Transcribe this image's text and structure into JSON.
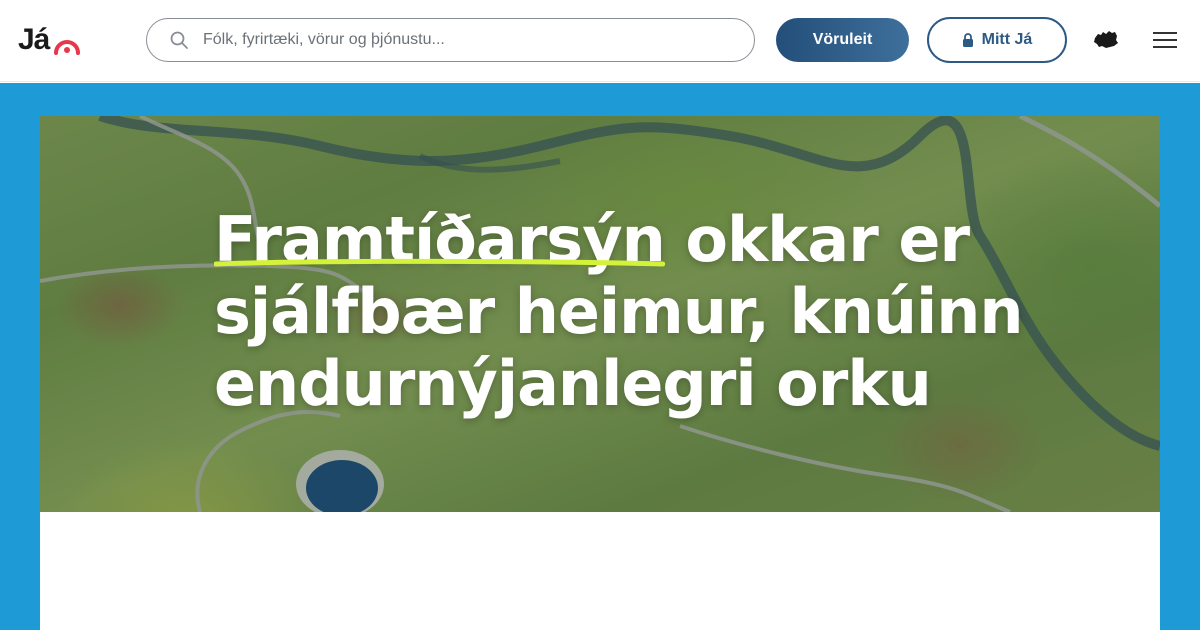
{
  "header": {
    "logo_text": "Já",
    "search_placeholder": "Fólk, fyrirtæki, vörur og þjónustu...",
    "voruleit_label": "Vöruleit",
    "mittja_label": "Mitt Já"
  },
  "icons": {
    "search": "search-icon",
    "lock": "lock-icon",
    "language": "iceland-map-icon",
    "menu": "hamburger-menu-icon"
  },
  "hero": {
    "title_highlight": "Framtíðarsýn",
    "title_rest_line1": " okkar er",
    "title_line2": "sjálfbær heimur, knúinn",
    "title_line3": "endurnýjanlegri orku"
  },
  "colors": {
    "backdrop_blue": "#1e9ad6",
    "button_blue": "#2c5a85",
    "highlight_lime": "#d4f23a",
    "logo_red": "#e8374b"
  }
}
